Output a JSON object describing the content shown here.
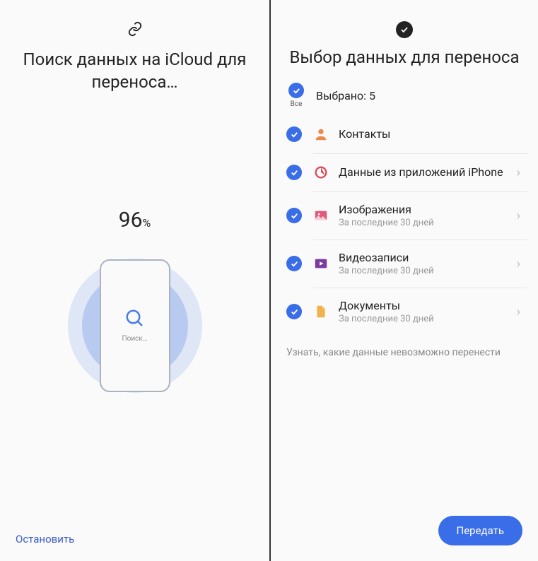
{
  "leftScreen": {
    "title": "Поиск данных на iCloud для переноса…",
    "percentValue": "96",
    "percentSymbol": "%",
    "graphicLabel": "Поиск…",
    "stopLabel": "Остановить"
  },
  "rightScreen": {
    "title": "Выбор данных для переноса",
    "allLabel": "Все",
    "selectedText": "Выбрано: 5",
    "items": [
      {
        "label": "Контакты",
        "sub": "",
        "hasChevron": false,
        "iconColor": "#e98b4a",
        "icon": "contact"
      },
      {
        "label": "Данные из приложений iPhone",
        "sub": "",
        "hasChevron": true,
        "iconColor": "#d94c5a",
        "icon": "pie"
      },
      {
        "label": "Изображения",
        "sub": "За последние 30 дней",
        "hasChevron": true,
        "iconColor": "#e05a7a",
        "icon": "image"
      },
      {
        "label": "Видеозаписи",
        "sub": "За последние 30 дней",
        "hasChevron": true,
        "iconColor": "#7a3a9e",
        "icon": "video"
      },
      {
        "label": "Документы",
        "sub": "За последние 30 дней",
        "hasChevron": true,
        "iconColor": "#f0b24a",
        "icon": "doc"
      }
    ],
    "infoLink": "Узнать, какие данные невозможно перенести",
    "transferLabel": "Передать"
  }
}
